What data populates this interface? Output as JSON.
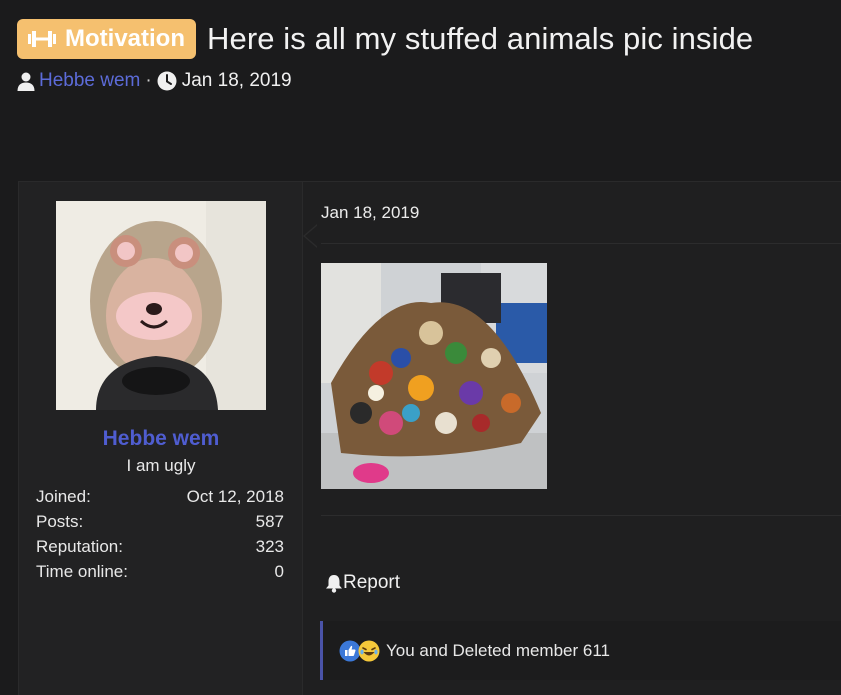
{
  "thread": {
    "prefix": "Motivation",
    "title": "Here is all my stuffed animals pic inside",
    "author": "Hebbe wem",
    "separator": "·",
    "date": "Jan 18, 2019"
  },
  "icons": {
    "prefix": "dumbbell-icon",
    "author": "user-icon",
    "date": "clock-icon",
    "report": "bell-icon",
    "reactions": [
      "like-icon",
      "laugh-icon"
    ]
  },
  "colors": {
    "accent": "#4f5dd0",
    "prefix_badge": "#f5c06f",
    "background": "#1b1b1c"
  },
  "post": {
    "date": "Jan 18, 2019",
    "report_label": "Report",
    "reactions_text": "You and Deleted member 611"
  },
  "user": {
    "name": "Hebbe wem",
    "title": "I am ugly",
    "stats": [
      {
        "label": "Joined:",
        "value": "Oct 12, 2018"
      },
      {
        "label": "Posts:",
        "value": "587"
      },
      {
        "label": "Reputation:",
        "value": "323"
      },
      {
        "label": "Time online:",
        "value": "0"
      }
    ]
  }
}
